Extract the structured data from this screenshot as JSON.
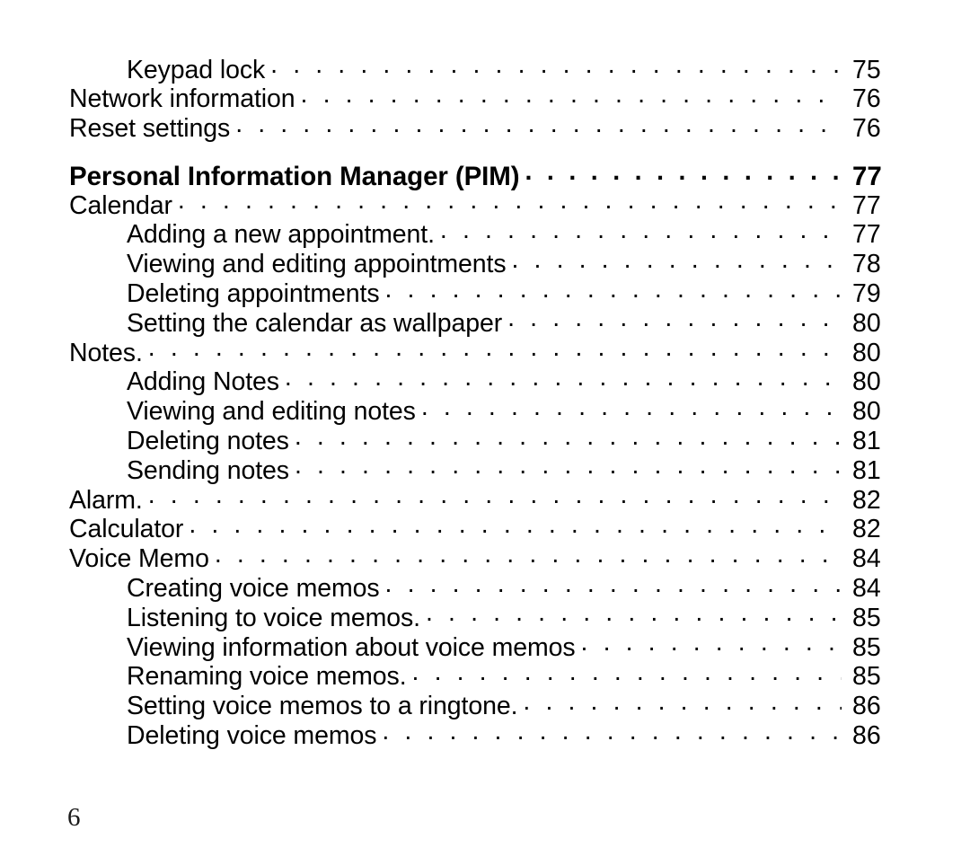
{
  "document": {
    "type": "table-of-contents",
    "folio": "6"
  },
  "toc": {
    "entries": [
      {
        "label": "Keypad lock",
        "page": "75",
        "level": 2,
        "bold": false,
        "gap_before": false
      },
      {
        "label": "Network information",
        "page": "76",
        "level": 1,
        "bold": false,
        "gap_before": false
      },
      {
        "label": "Reset settings",
        "page": "76",
        "level": 1,
        "bold": false,
        "gap_before": false
      },
      {
        "label": "Personal Information Manager (PIM)",
        "page": "77",
        "level": 1,
        "bold": true,
        "gap_before": true
      },
      {
        "label": "Calendar",
        "page": "77",
        "level": 1,
        "bold": false,
        "gap_before": false
      },
      {
        "label": "Adding a new appointment.",
        "page": "77",
        "level": 2,
        "bold": false,
        "gap_before": false
      },
      {
        "label": "Viewing and editing appointments",
        "page": "78",
        "level": 2,
        "bold": false,
        "gap_before": false
      },
      {
        "label": "Deleting appointments",
        "page": "79",
        "level": 2,
        "bold": false,
        "gap_before": false
      },
      {
        "label": "Setting the calendar as wallpaper",
        "page": "80",
        "level": 2,
        "bold": false,
        "gap_before": false
      },
      {
        "label": "Notes.",
        "page": "80",
        "level": 1,
        "bold": false,
        "gap_before": false
      },
      {
        "label": "Adding Notes",
        "page": "80",
        "level": 2,
        "bold": false,
        "gap_before": false
      },
      {
        "label": "Viewing and editing notes",
        "page": "80",
        "level": 2,
        "bold": false,
        "gap_before": false
      },
      {
        "label": "Deleting notes",
        "page": "81",
        "level": 2,
        "bold": false,
        "gap_before": false
      },
      {
        "label": "Sending notes",
        "page": "81",
        "level": 2,
        "bold": false,
        "gap_before": false
      },
      {
        "label": "Alarm.",
        "page": "82",
        "level": 1,
        "bold": false,
        "gap_before": false
      },
      {
        "label": "Calculator",
        "page": "82",
        "level": 1,
        "bold": false,
        "gap_before": false
      },
      {
        "label": "Voice Memo",
        "page": "84",
        "level": 1,
        "bold": false,
        "gap_before": false
      },
      {
        "label": "Creating voice memos",
        "page": "84",
        "level": 2,
        "bold": false,
        "gap_before": false
      },
      {
        "label": "Listening to voice memos.",
        "page": "85",
        "level": 2,
        "bold": false,
        "gap_before": false
      },
      {
        "label": "Viewing information about voice memos",
        "page": "85",
        "level": 2,
        "bold": false,
        "gap_before": false
      },
      {
        "label": "Renaming voice memos.",
        "page": "85",
        "level": 2,
        "bold": false,
        "gap_before": false
      },
      {
        "label": "Setting voice memos to a ringtone.",
        "page": "86",
        "level": 2,
        "bold": false,
        "gap_before": false
      },
      {
        "label": "Deleting voice memos",
        "page": "86",
        "level": 2,
        "bold": false,
        "gap_before": false
      }
    ]
  },
  "colors": {
    "page_background": "#ffffff",
    "text": "#000000",
    "folio_text": "#1a1a1a"
  }
}
